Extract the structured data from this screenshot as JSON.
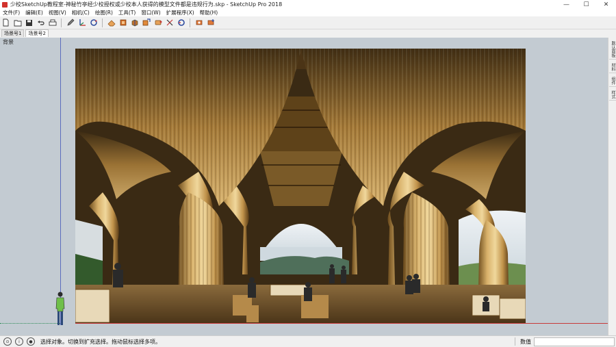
{
  "window": {
    "title": "少校SketchUp教程室-神秘竹亭经少校授权或少校本人获得的模型文件都是违规行为.skp - SketchUp Pro 2018",
    "minimize": "—",
    "maximize": "☐",
    "close": "✕"
  },
  "menu": [
    "文件(F)",
    "编辑(E)",
    "视图(V)",
    "相机(C)",
    "绘图(R)",
    "工具(T)",
    "窗口(W)",
    "扩展程序(X)",
    "帮助(H)"
  ],
  "toolbar": {
    "groups": [
      [
        "new-file-icon",
        "open-file-icon",
        "save-icon",
        "undo-icon",
        "print-icon"
      ],
      [
        "pencil-icon",
        "axes-icon",
        "rotate-icon"
      ],
      [
        "eraser-icon",
        "paint-icon",
        "push-pull-icon",
        "move-icon",
        "tape-measure-icon",
        "scissors-icon",
        "orbit-icon"
      ],
      [
        "camera-icon",
        "camera-add-icon"
      ]
    ]
  },
  "tabs": [
    "场景号1",
    "场景号2"
  ],
  "active_tab": 1,
  "viewport": {
    "scene_label": "背景",
    "photo_alt_subject": "bamboo pavilion"
  },
  "right_tray": [
    "默认面板",
    "材料",
    "组件",
    "样式"
  ],
  "status": {
    "icons": [
      "geo-location-icon",
      "info-icon",
      "user-icon"
    ],
    "message": "选择对象。切换到扩充选择。拖动鼠标选择多项。",
    "measure_label": "数值",
    "measure_value": ""
  },
  "colors": {
    "viewport_bg": "#c3cbd2",
    "axis_red": "#c83a3a",
    "axis_blue": "#5a6bbd",
    "axis_green": "#2e8b57"
  }
}
